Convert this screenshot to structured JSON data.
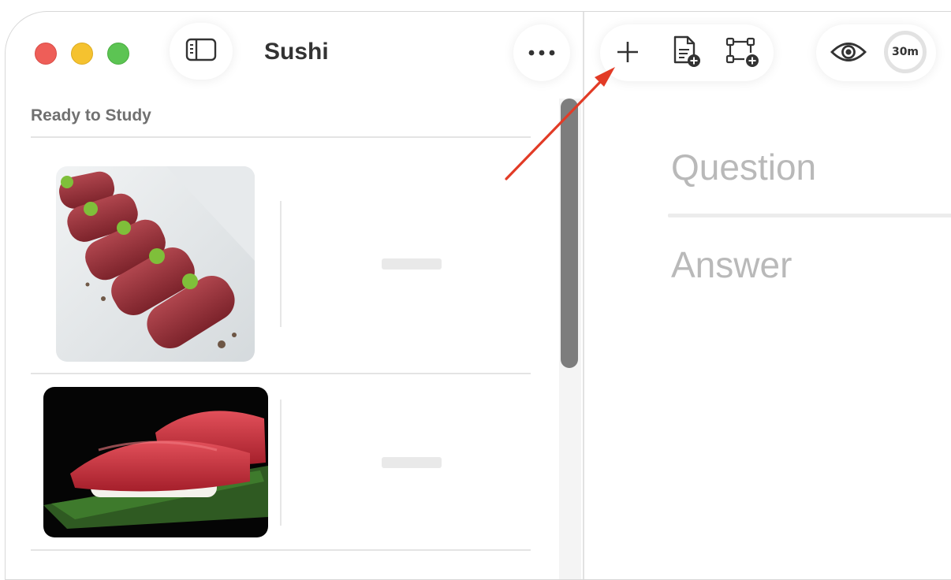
{
  "window": {
    "title": "Sushi"
  },
  "sidebar": {
    "section_label": "Ready to Study",
    "cards": [
      {
        "image": "seared-wagyu-nigiri-photo"
      },
      {
        "image": "tuna-nigiri-photo"
      }
    ]
  },
  "toolbar": {
    "left_icons": [
      "sidebar-toggle-icon",
      "more-options-icon"
    ],
    "add_group_icons": [
      "plus-icon",
      "add-document-icon",
      "add-diagram-icon"
    ],
    "right_icons": [
      "eye-icon"
    ],
    "timer_label": "30m"
  },
  "editor": {
    "question_placeholder": "Question",
    "answer_placeholder": "Answer"
  },
  "colors": {
    "close": "#ee5e58",
    "minimize": "#f5c22f",
    "zoom": "#5cc453",
    "annotation_arrow": "#e23b26",
    "placeholder_text": "#b9b9b9"
  }
}
